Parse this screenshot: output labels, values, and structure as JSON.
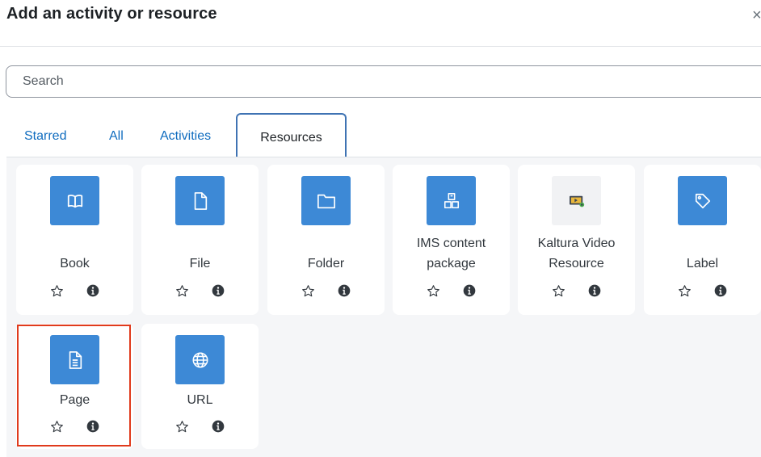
{
  "modal": {
    "title": "Add an activity or resource",
    "close_glyph": "×"
  },
  "search": {
    "placeholder": "Search",
    "value": ""
  },
  "tabs": [
    {
      "label": "Starred",
      "active": false
    },
    {
      "label": "All",
      "active": false
    },
    {
      "label": "Activities",
      "active": false
    },
    {
      "label": "Resources",
      "active": true
    }
  ],
  "items": [
    {
      "name_lines": [
        "Book"
      ],
      "icon": "book-icon"
    },
    {
      "name_lines": [
        "File"
      ],
      "icon": "file-icon"
    },
    {
      "name_lines": [
        "Folder"
      ],
      "icon": "folder-icon"
    },
    {
      "name_lines": [
        "IMS content",
        "package"
      ],
      "icon": "ims-package-icon"
    },
    {
      "name_lines": [
        "Kaltura Video",
        "Resource"
      ],
      "icon": "kaltura-video-icon"
    },
    {
      "name_lines": [
        "Label"
      ],
      "icon": "label-tag-icon"
    },
    {
      "name_lines": [
        "Page"
      ],
      "icon": "page-document-icon",
      "highlighted": true
    },
    {
      "name_lines": [
        "URL"
      ],
      "icon": "globe-icon"
    }
  ],
  "colors": {
    "accent": "#0f6cbf",
    "icon_bg": "#3d89d6",
    "highlight": "#e03a1c",
    "tab_border": "#3f73b3"
  }
}
